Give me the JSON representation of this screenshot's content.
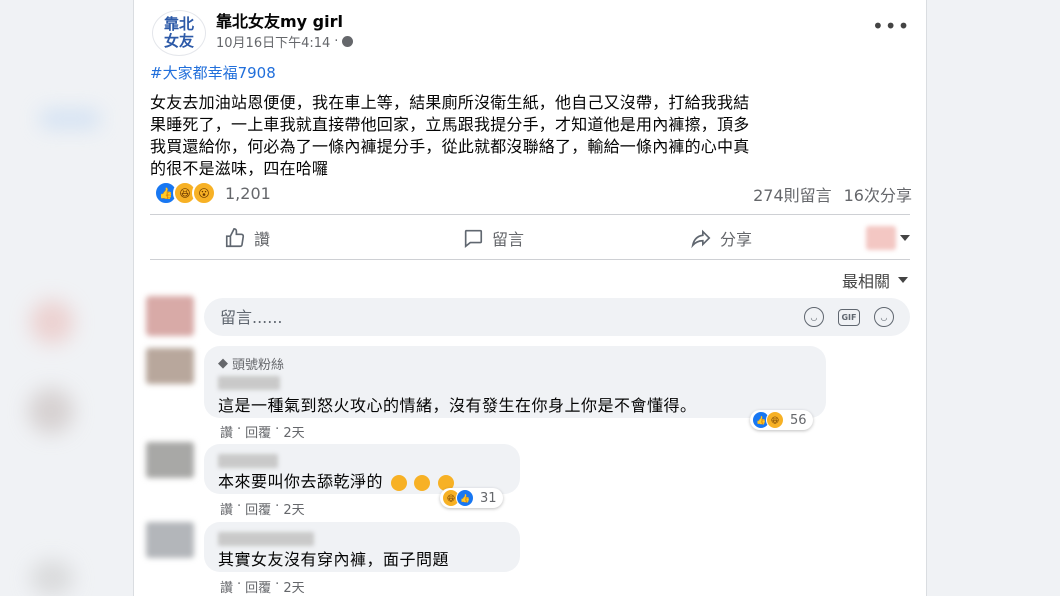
{
  "post": {
    "page_name": "靠北女友my girl",
    "avatar_text": [
      "靠北",
      "女友"
    ],
    "timestamp": "10月16日下午4:14",
    "separator": "·",
    "more_label": "•••",
    "hashtag": "#大家都幸福7908",
    "body_lines": [
      "女友去加油站恩便便，我在車上等，結果廁所沒衛生紙，他自己又沒帶，打給我我結",
      "果睡死了，一上車我就直接帶他回家，立馬跟我提分手，才知道他是用內褲擦，頂多",
      "我買還給你，何必為了一條內褲提分手，從此就都沒聯絡了，輸給一條內褲的心中真",
      "的很不是滋味，四在哈囉"
    ],
    "reaction_count": "1,201",
    "comments_count": "274則留言",
    "shares_count": "16次分享"
  },
  "actions": {
    "like": "讚",
    "comment": "留言",
    "share": "分享"
  },
  "sort_label": "最相關",
  "composer": {
    "placeholder": "留言......"
  },
  "comments": [
    {
      "badge": "頭號粉絲",
      "text": "這是一種氣到怒火攻心的情緒，沒有發生在你身上你是不會懂得。",
      "reaction_count": "56",
      "like": "讚",
      "reply": "回覆",
      "time": "2天"
    },
    {
      "text": "本來要叫你去舔乾淨的",
      "reaction_count": "31",
      "like": "讚",
      "reply": "回覆",
      "time": "2天"
    },
    {
      "text": "其實女友沒有穿內褲，面子問題",
      "like": "讚",
      "reply": "回覆",
      "time": "2天"
    }
  ],
  "colors": {
    "link": "#216fdb",
    "like_blue": "#1877f2",
    "secondary_text": "#65676b",
    "bubble_bg": "#f0f2f5"
  }
}
